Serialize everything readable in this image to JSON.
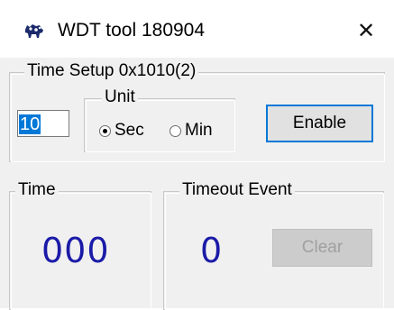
{
  "window": {
    "title": "WDT tool 180904",
    "close_glyph": "✕",
    "app_icon": "cow-icon"
  },
  "time_setup": {
    "legend": "Time Setup 0x1010(2)",
    "value": "10",
    "unit": {
      "legend": "Unit",
      "options": [
        {
          "label": "Sec",
          "checked": true
        },
        {
          "label": "Min",
          "checked": false
        }
      ]
    },
    "enable_label": "Enable"
  },
  "time_group": {
    "legend": "Time",
    "value": "000"
  },
  "timeout_group": {
    "legend": "Timeout Event",
    "value": "0",
    "clear_label": "Clear"
  },
  "colors": {
    "digits": "#1a1aa8",
    "focus": "#0078d7"
  }
}
